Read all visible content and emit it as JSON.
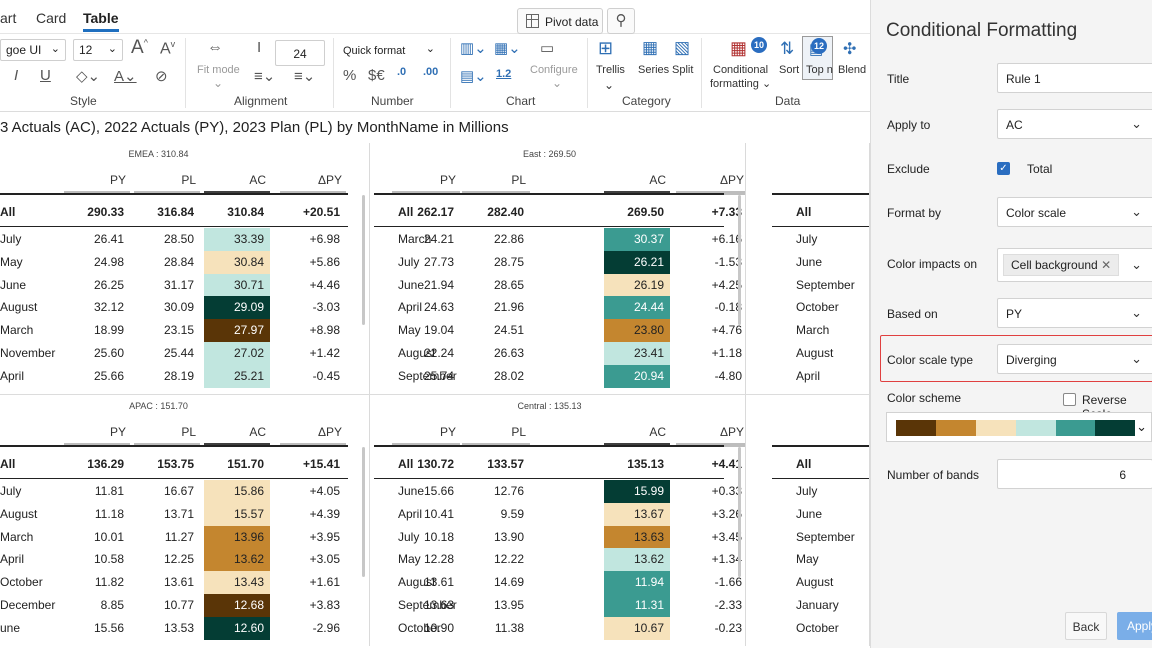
{
  "tabs": [
    "art",
    "Card",
    "Table"
  ],
  "toolbar": {
    "pivot_label": "Pivot data",
    "font_name": "goe UI",
    "font_size": "12",
    "width_value": "24",
    "quick_format": "Quick format",
    "fit_mode": "Fit mode",
    "configure": "Configure",
    "trellis": "Trellis",
    "series": "Series",
    "split": "Split",
    "cond_line1": "Conditional",
    "cond_line2": "formatting",
    "cond_badge": "10",
    "sort": "Sort",
    "topn": "Top n",
    "topn_badge": "12",
    "blend": "Blend",
    "num_a": ".0",
    "num_b": ".00",
    "precision": "1.2",
    "groups": {
      "style": "Style",
      "alignment": "Alignment",
      "number": "Number",
      "chart": "Chart",
      "category": "Category",
      "data": "Data"
    }
  },
  "chart_title": "3 Actuals (AC), 2022 Actuals (PY), 2023 Plan (PL) by MonthName in Millions",
  "headers": {
    "py": "PY",
    "pl": "PL",
    "ac": "AC",
    "dpy": "ΔPY"
  },
  "colors": {
    "c1": "#5a3507",
    "c2": "#c4862f",
    "c3": "#f6e2bb",
    "c4": "#c1e6df",
    "c5": "#3b9b91",
    "c6": "#043d34"
  },
  "panels": [
    {
      "title": "EMEA : 310.84",
      "total": {
        "name": "All",
        "py": "290.33",
        "pl": "316.84",
        "ac": "310.84",
        "dpy": "+20.51"
      },
      "rows": [
        {
          "name": "July",
          "py": "26.41",
          "pl": "28.50",
          "ac": "33.39",
          "dpy": "+6.98",
          "bg": "#c1e6df",
          "fg": "#222"
        },
        {
          "name": "May",
          "py": "24.98",
          "pl": "28.84",
          "ac": "30.84",
          "dpy": "+5.86",
          "bg": "#f6e2bb",
          "fg": "#222"
        },
        {
          "name": "June",
          "py": "26.25",
          "pl": "31.17",
          "ac": "30.71",
          "dpy": "+4.46",
          "bg": "#c1e6df",
          "fg": "#222"
        },
        {
          "name": "August",
          "py": "32.12",
          "pl": "30.09",
          "ac": "29.09",
          "dpy": "-3.03",
          "bg": "#043d34",
          "fg": "#fff"
        },
        {
          "name": "March",
          "py": "18.99",
          "pl": "23.15",
          "ac": "27.97",
          "dpy": "+8.98",
          "bg": "#5a3507",
          "fg": "#fff"
        },
        {
          "name": "November",
          "py": "25.60",
          "pl": "25.44",
          "ac": "27.02",
          "dpy": "+1.42",
          "bg": "#c1e6df",
          "fg": "#222"
        },
        {
          "name": "April",
          "py": "25.66",
          "pl": "28.19",
          "ac": "25.21",
          "dpy": "-0.45",
          "bg": "#c1e6df",
          "fg": "#222"
        }
      ]
    },
    {
      "title": "East : 269.50",
      "total": {
        "name": "All",
        "py": "262.17",
        "pl": "282.40",
        "ac": "269.50",
        "dpy": "+7.33"
      },
      "rows": [
        {
          "name": "March",
          "py": "24.21",
          "pl": "22.86",
          "ac": "30.37",
          "dpy": "+6.16",
          "bg": "#3b9b91",
          "fg": "#fff"
        },
        {
          "name": "July",
          "py": "27.73",
          "pl": "28.75",
          "ac": "26.21",
          "dpy": "-1.53",
          "bg": "#043d34",
          "fg": "#fff"
        },
        {
          "name": "June",
          "py": "21.94",
          "pl": "28.65",
          "ac": "26.19",
          "dpy": "+4.25",
          "bg": "#f6e2bb",
          "fg": "#222"
        },
        {
          "name": "April",
          "py": "24.63",
          "pl": "21.96",
          "ac": "24.44",
          "dpy": "-0.18",
          "bg": "#3b9b91",
          "fg": "#fff"
        },
        {
          "name": "May",
          "py": "19.04",
          "pl": "24.51",
          "ac": "23.80",
          "dpy": "+4.76",
          "bg": "#c4862f",
          "fg": "#222"
        },
        {
          "name": "August",
          "py": "22.24",
          "pl": "26.63",
          "ac": "23.41",
          "dpy": "+1.18",
          "bg": "#c1e6df",
          "fg": "#222"
        },
        {
          "name": "September",
          "py": "25.74",
          "pl": "28.02",
          "ac": "20.94",
          "dpy": "-4.80",
          "bg": "#3b9b91",
          "fg": "#fff"
        }
      ]
    },
    {
      "title": "",
      "total": {
        "name": "All"
      },
      "rows": [
        {
          "name": "July"
        },
        {
          "name": "June"
        },
        {
          "name": "September"
        },
        {
          "name": "October"
        },
        {
          "name": "March"
        },
        {
          "name": "August"
        },
        {
          "name": "April"
        }
      ]
    },
    {
      "title": "APAC : 151.70",
      "total": {
        "name": "All",
        "py": "136.29",
        "pl": "153.75",
        "ac": "151.70",
        "dpy": "+15.41"
      },
      "rows": [
        {
          "name": "July",
          "py": "11.81",
          "pl": "16.67",
          "ac": "15.86",
          "dpy": "+4.05",
          "bg": "#f6e2bb",
          "fg": "#222"
        },
        {
          "name": "August",
          "py": "11.18",
          "pl": "13.71",
          "ac": "15.57",
          "dpy": "+4.39",
          "bg": "#f6e2bb",
          "fg": "#222"
        },
        {
          "name": "March",
          "py": "10.01",
          "pl": "11.27",
          "ac": "13.96",
          "dpy": "+3.95",
          "bg": "#c4862f",
          "fg": "#222"
        },
        {
          "name": "April",
          "py": "10.58",
          "pl": "12.25",
          "ac": "13.62",
          "dpy": "+3.05",
          "bg": "#c4862f",
          "fg": "#222"
        },
        {
          "name": "October",
          "py": "11.82",
          "pl": "13.61",
          "ac": "13.43",
          "dpy": "+1.61",
          "bg": "#f6e2bb",
          "fg": "#222"
        },
        {
          "name": "December",
          "py": "8.85",
          "pl": "10.77",
          "ac": "12.68",
          "dpy": "+3.83",
          "bg": "#5a3507",
          "fg": "#fff"
        },
        {
          "name": "une",
          "py": "15.56",
          "pl": "13.53",
          "ac": "12.60",
          "dpy": "-2.96",
          "bg": "#043d34",
          "fg": "#fff"
        }
      ]
    },
    {
      "title": "Central : 135.13",
      "total": {
        "name": "All",
        "py": "130.72",
        "pl": "133.57",
        "ac": "135.13",
        "dpy": "+4.41"
      },
      "rows": [
        {
          "name": "June",
          "py": "15.66",
          "pl": "12.76",
          "ac": "15.99",
          "dpy": "+0.33",
          "bg": "#043d34",
          "fg": "#fff"
        },
        {
          "name": "April",
          "py": "10.41",
          "pl": "9.59",
          "ac": "13.67",
          "dpy": "+3.26",
          "bg": "#f6e2bb",
          "fg": "#222"
        },
        {
          "name": "July",
          "py": "10.18",
          "pl": "13.90",
          "ac": "13.63",
          "dpy": "+3.45",
          "bg": "#c4862f",
          "fg": "#222"
        },
        {
          "name": "May",
          "py": "12.28",
          "pl": "12.22",
          "ac": "13.62",
          "dpy": "+1.34",
          "bg": "#c1e6df",
          "fg": "#222"
        },
        {
          "name": "August",
          "py": "13.61",
          "pl": "14.69",
          "ac": "11.94",
          "dpy": "-1.66",
          "bg": "#3b9b91",
          "fg": "#fff"
        },
        {
          "name": "September",
          "py": "13.63",
          "pl": "13.95",
          "ac": "11.31",
          "dpy": "-2.33",
          "bg": "#3b9b91",
          "fg": "#fff"
        },
        {
          "name": "October",
          "py": "10.90",
          "pl": "11.38",
          "ac": "10.67",
          "dpy": "-0.23",
          "bg": "#f6e2bb",
          "fg": "#222"
        }
      ]
    },
    {
      "title": "",
      "total": {
        "name": "All"
      },
      "rows": [
        {
          "name": "July"
        },
        {
          "name": "June"
        },
        {
          "name": "September"
        },
        {
          "name": "May"
        },
        {
          "name": "August"
        },
        {
          "name": "January"
        },
        {
          "name": "October"
        }
      ]
    }
  ],
  "cf": {
    "heading": "Conditional Formatting",
    "title_label": "Title",
    "title_value": "Rule 1",
    "apply_label": "Apply to",
    "apply_value": "AC",
    "exclude_label": "Exclude",
    "exclude_value": "Total",
    "formatby_label": "Format by",
    "formatby_value": "Color scale",
    "impacts_label": "Color impacts on",
    "impacts_value": "Cell background",
    "basedon_label": "Based on",
    "basedon_value": "PY",
    "scaletype_label": "Color scale type",
    "scaletype_value": "Diverging",
    "scheme_label": "Color scheme",
    "reverse_label": "Reverse Scale",
    "bands_label": "Number of bands",
    "bands_value": "6",
    "back": "Back",
    "apply": "Apply"
  }
}
